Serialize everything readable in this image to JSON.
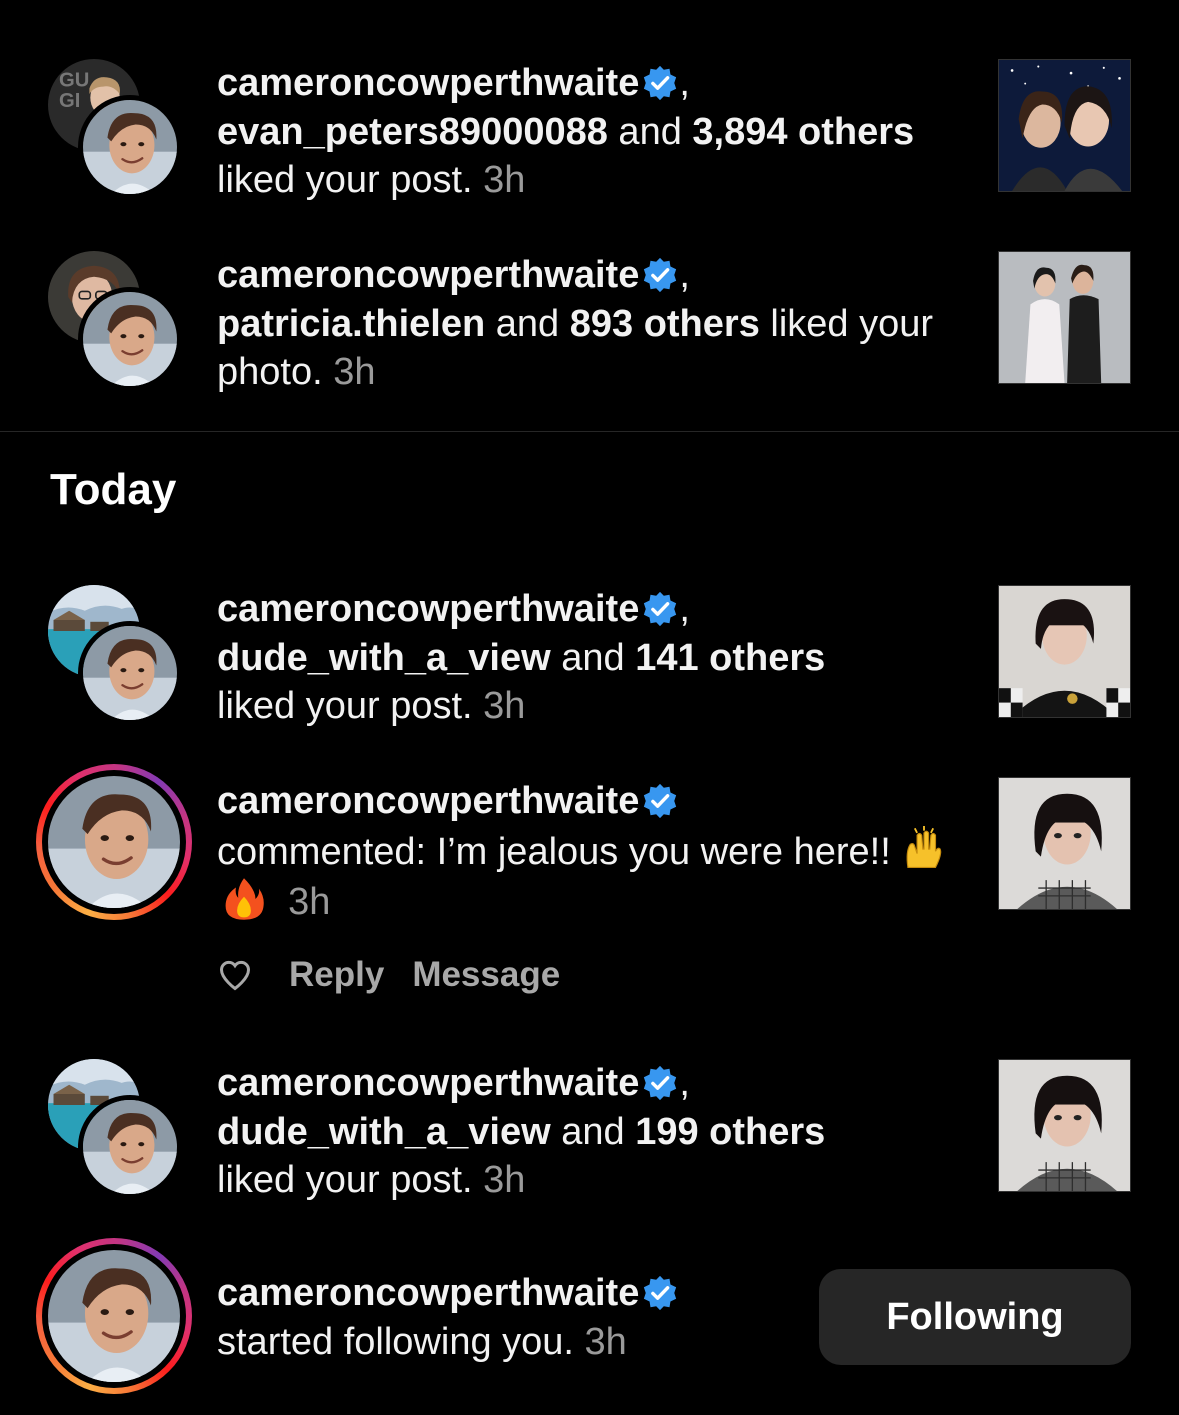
{
  "notifications_earlier": [
    {
      "user": "cameroncowperthwaite",
      "suffix": ",",
      "second_user": "evan_peters89000088",
      "joiner": " and ",
      "others": "3,894 others",
      "action": " liked your post. ",
      "time": "3h"
    },
    {
      "user": "cameroncowperthwaite",
      "suffix": ",",
      "second_user": "patricia.thielen",
      "joiner": " and ",
      "others": "893 others",
      "action": " liked your photo. ",
      "time": "3h"
    }
  ],
  "section": {
    "today": "Today"
  },
  "notifications_today": [
    {
      "user": "cameroncowperthwaite",
      "suffix": ",",
      "second_user": "dude_with_a_view",
      "joiner": " and ",
      "others": "141 others",
      "action": " liked your post. ",
      "time": "3h"
    },
    {
      "user": "cameroncowperthwaite",
      "comment": "commented: I’m jealous you were here!! ",
      "time": "3h"
    },
    {
      "user": "cameroncowperthwaite",
      "suffix": ",",
      "second_user": "dude_with_a_view",
      "joiner": " and ",
      "others": "199 others",
      "action": " liked your post. ",
      "time": "3h"
    },
    {
      "user": "cameroncowperthwaite",
      "action": "started following you. ",
      "time": "3h"
    }
  ],
  "comment_actions": {
    "reply": "Reply",
    "message": "Message"
  },
  "follow_button": {
    "label": "Following"
  },
  "colors": {
    "verified": "#3897f0",
    "button_bg": "#262626",
    "muted": "#9a9a9a"
  }
}
